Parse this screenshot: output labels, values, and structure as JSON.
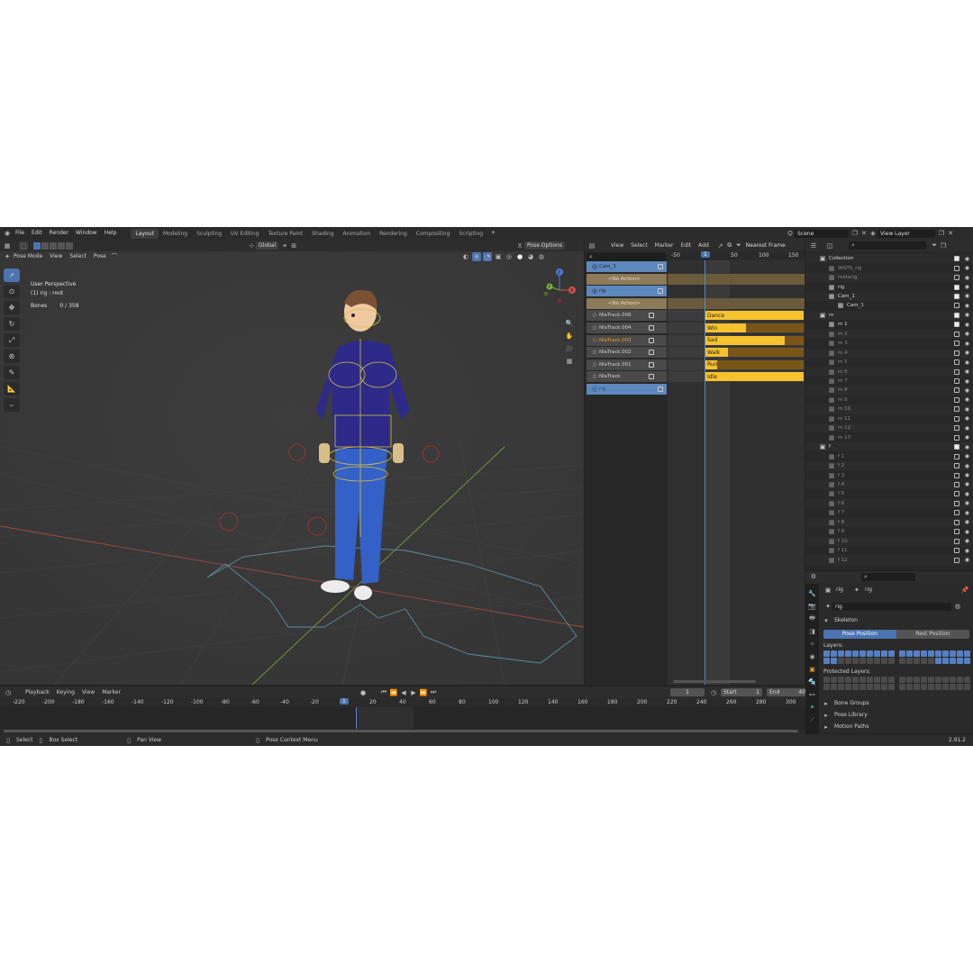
{
  "topbar": {
    "menus": [
      "File",
      "Edit",
      "Render",
      "Window",
      "Help"
    ],
    "workspaces": [
      "Layout",
      "Modeling",
      "Sculpting",
      "UV Editing",
      "Texture Paint",
      "Shading",
      "Animation",
      "Rendering",
      "Compositing",
      "Scripting"
    ],
    "active_workspace": "Layout",
    "add_tab": "+",
    "scene": "Scene",
    "view_layer": "View Layer"
  },
  "viewport": {
    "mode": "Pose Mode",
    "menus": [
      "View",
      "Select",
      "Pose"
    ],
    "orientation": "Global",
    "pose_options": "Pose Options",
    "info_title": "User Perspective",
    "info_object": "(1) rig : root",
    "bones_label": "Bones",
    "bones_value": "0 / 358",
    "gizmo_x": "X",
    "gizmo_y": "Y",
    "gizmo_z": "Z"
  },
  "nla": {
    "menus": [
      "View",
      "Select",
      "Marker",
      "Edit",
      "Add"
    ],
    "snap": "Nearest Frame",
    "ruler": [
      "-50",
      "1",
      "50",
      "100",
      "150"
    ],
    "tracks": [
      {
        "label": "Cam_1",
        "kind": "object"
      },
      {
        "label": "<No Action>",
        "kind": "action"
      },
      {
        "label": "rig",
        "kind": "object"
      },
      {
        "label": "<No Action>",
        "kind": "action"
      },
      {
        "label": "NlaTrack.006",
        "kind": "track"
      },
      {
        "label": "NlaTrack.004",
        "kind": "track"
      },
      {
        "label": "NlaTrack.003",
        "kind": "track-active"
      },
      {
        "label": "NlaTrack.002",
        "kind": "track"
      },
      {
        "label": "NlaTrack.001",
        "kind": "track"
      },
      {
        "label": "NlaTrack",
        "kind": "track"
      },
      {
        "label": "rig",
        "kind": "object-collapsed"
      }
    ],
    "strips": [
      {
        "label": "Dance",
        "fill": 1.0
      },
      {
        "label": "Win",
        "fill": 0.42
      },
      {
        "label": "Sad",
        "fill": 0.81
      },
      {
        "label": "Walk",
        "fill": 0.24
      },
      {
        "label": "Run",
        "fill": 0.13
      },
      {
        "label": "Idle",
        "fill": 1.0
      }
    ]
  },
  "outliner": {
    "rows": [
      {
        "label": "Collection",
        "depth": 0,
        "checked": true
      },
      {
        "label": "WGTS_rig",
        "depth": 1,
        "checked": false,
        "dim": true
      },
      {
        "label": "metarig",
        "depth": 1,
        "checked": false,
        "dim": true
      },
      {
        "label": "rig",
        "depth": 1,
        "checked": true
      },
      {
        "label": "Cam_1",
        "depth": 1,
        "checked": true
      },
      {
        "label": "Cam_1",
        "depth": 2,
        "checked": false
      },
      {
        "label": "m",
        "depth": 0,
        "checked": true
      },
      {
        "label": "m 1",
        "depth": 1,
        "checked": true
      },
      {
        "label": "m 2",
        "depth": 1,
        "checked": false,
        "dim": true
      },
      {
        "label": "m 3",
        "depth": 1,
        "checked": false,
        "dim": true
      },
      {
        "label": "m 4",
        "depth": 1,
        "checked": false,
        "dim": true
      },
      {
        "label": "m 5",
        "depth": 1,
        "checked": false,
        "dim": true
      },
      {
        "label": "m 6",
        "depth": 1,
        "checked": false,
        "dim": true
      },
      {
        "label": "m 7",
        "depth": 1,
        "checked": false,
        "dim": true
      },
      {
        "label": "m 8",
        "depth": 1,
        "checked": false,
        "dim": true
      },
      {
        "label": "m 9",
        "depth": 1,
        "checked": false,
        "dim": true
      },
      {
        "label": "m 10",
        "depth": 1,
        "checked": false,
        "dim": true
      },
      {
        "label": "m 11",
        "depth": 1,
        "checked": false,
        "dim": true
      },
      {
        "label": "m 12",
        "depth": 1,
        "checked": false,
        "dim": true
      },
      {
        "label": "m 13",
        "depth": 1,
        "checked": false,
        "dim": true
      },
      {
        "label": "f",
        "depth": 0,
        "checked": true
      },
      {
        "label": "f 1",
        "depth": 1,
        "checked": false,
        "dim": true
      },
      {
        "label": "f 2",
        "depth": 1,
        "checked": false,
        "dim": true
      },
      {
        "label": "f 3",
        "depth": 1,
        "checked": false,
        "dim": true
      },
      {
        "label": "f 4",
        "depth": 1,
        "checked": false,
        "dim": true
      },
      {
        "label": "f 5",
        "depth": 1,
        "checked": false,
        "dim": true
      },
      {
        "label": "f 6",
        "depth": 1,
        "checked": false,
        "dim": true
      },
      {
        "label": "f 7",
        "depth": 1,
        "checked": false,
        "dim": true
      },
      {
        "label": "f 8",
        "depth": 1,
        "checked": false,
        "dim": true
      },
      {
        "label": "f 9",
        "depth": 1,
        "checked": false,
        "dim": true
      },
      {
        "label": "f 10",
        "depth": 1,
        "checked": false,
        "dim": true
      },
      {
        "label": "f 11",
        "depth": 1,
        "checked": false,
        "dim": true
      },
      {
        "label": "f 12",
        "depth": 1,
        "checked": false,
        "dim": true
      }
    ]
  },
  "properties": {
    "crumb_object": "rig",
    "crumb_data": "rig",
    "data_name": "rig",
    "skeleton": "Skeleton",
    "pose_position": "Pose Position",
    "rest_position": "Rest Position",
    "layers": "Layers:",
    "protected_layers": "Protected Layers:",
    "bone_groups": "Bone Groups",
    "pose_library": "Pose Library",
    "motion_paths": "Motion Paths"
  },
  "timeline": {
    "menus": [
      "Playback",
      "Keying",
      "View",
      "Marker"
    ],
    "current_frame": "1",
    "start_label": "Start",
    "start": "1",
    "end_label": "End",
    "end": "40",
    "ruler": [
      "-220",
      "-200",
      "-180",
      "-160",
      "-140",
      "-120",
      "-100",
      "-80",
      "-60",
      "-40",
      "-20",
      "1",
      "20",
      "40",
      "60",
      "80",
      "100",
      "120",
      "140",
      "160",
      "180",
      "200",
      "220",
      "240",
      "260",
      "280",
      "300"
    ]
  },
  "statusbar": {
    "select": "Select",
    "box_select": "Box Select",
    "pan_view": "Pan View",
    "context_menu": "Pose Context Menu",
    "version": "2.91.2"
  },
  "colors": {
    "accent": "#4c74b0",
    "strip_yellow": "#f7c22e",
    "strip_brown": "#7a5518",
    "track_blue": "#5d88bd",
    "action_tan": "#8c7a58"
  }
}
